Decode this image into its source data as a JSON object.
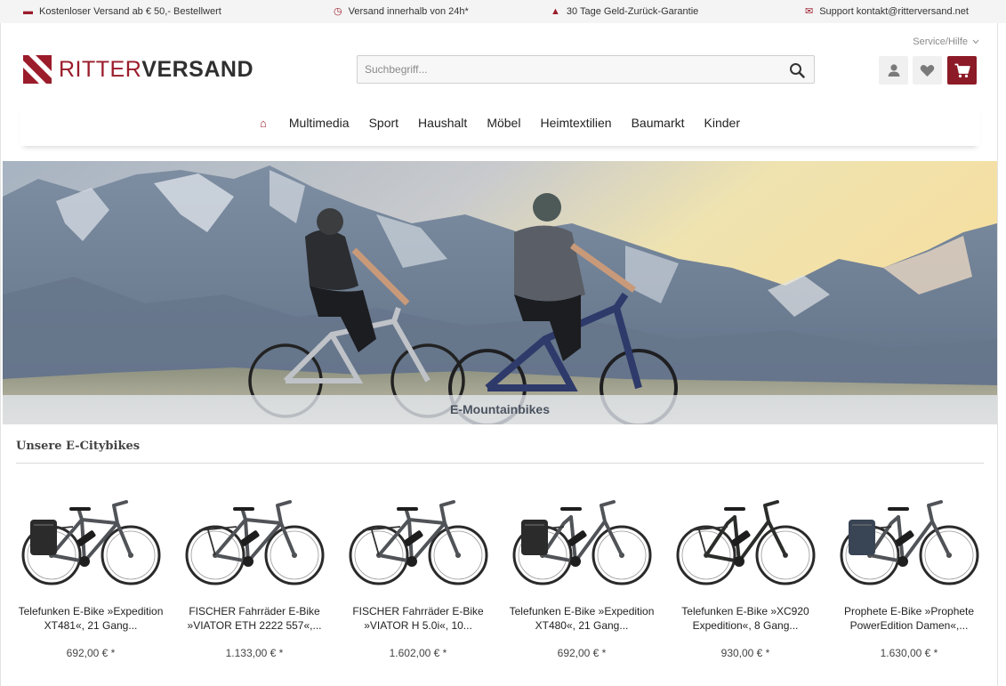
{
  "topbar": {
    "items": [
      {
        "icon": "truck-icon",
        "text": "Kostenloser Versand ab € 50,- Bestellwert"
      },
      {
        "icon": "clock-icon",
        "text": "Versand innerhalb von 24h*"
      },
      {
        "icon": "thumbs-up-icon",
        "text": "30 Tage Geld-Zurück-Garantie"
      },
      {
        "icon": "mail-icon",
        "text": "Support kontakt@ritterversand.net"
      }
    ]
  },
  "header": {
    "service_label": "Service/Hilfe",
    "logo": {
      "part1": "RITTER",
      "part2": "VERSAND"
    },
    "search_placeholder": "Suchbegriff..."
  },
  "nav": {
    "items": [
      "Multimedia",
      "Sport",
      "Haushalt",
      "Möbel",
      "Heimtextilien",
      "Baumarkt",
      "Kinder"
    ]
  },
  "hero": {
    "caption": "E-Mountainbikes"
  },
  "section": {
    "title": "Unsere E-Citybikes"
  },
  "products": [
    {
      "line1": "Telefunken E-Bike »Expedition",
      "line2": "XT481«, 21 Gang...",
      "price": "692,00 € *",
      "frame": "man",
      "bag": true
    },
    {
      "line1": "FISCHER Fahrräder E-Bike",
      "line2": "»VIATOR ETH 2222 557«,...",
      "price": "1.133,00 € *",
      "frame": "man",
      "bag": false
    },
    {
      "line1": "FISCHER Fahrräder E-Bike",
      "line2": "»VIATOR H 5.0i«, 10...",
      "price": "1.602,00 € *",
      "frame": "man",
      "bag": false
    },
    {
      "line1": "Telefunken E-Bike »Expedition",
      "line2": "XT480«, 21 Gang...",
      "price": "692,00 € *",
      "frame": "lady",
      "bag": true
    },
    {
      "line1": "Telefunken E-Bike »XC920",
      "line2": "Expedition«, 8 Gang...",
      "price": "930,00 € *",
      "frame": "lady",
      "bag": false
    },
    {
      "line1": "Prophete E-Bike »Prophete",
      "line2": "PowerEdition Damen«,...",
      "price": "1.630,00 € *",
      "frame": "lady",
      "bag": true
    }
  ],
  "colors": {
    "brand": "#9b1c2b",
    "cart": "#8d1a27",
    "topbar_bg": "#f4f4f4"
  }
}
